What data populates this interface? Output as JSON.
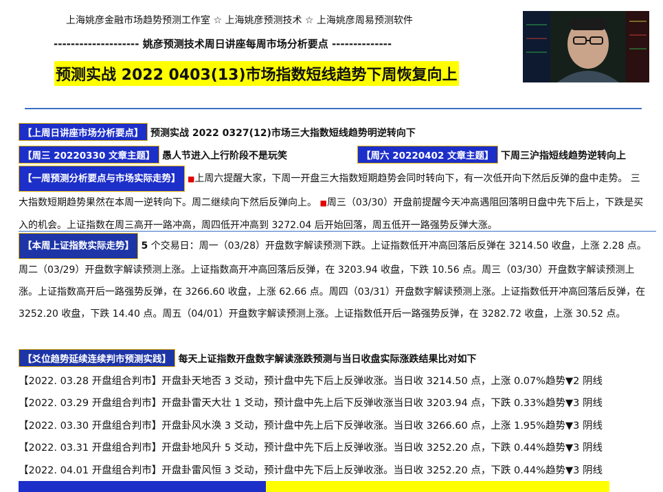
{
  "header": {
    "studio_line": "上海姚彦金融市场趋势预测工作室 ☆ 上海姚彦预测技术 ☆ 上海姚彦周易预测软件",
    "subtitle_line": "--------------------  姚彦预测技术周日讲座每周市场分析要点    --------------",
    "title": "预测实战 2022 0403(13)市场指数短线趋势下周恢复向上"
  },
  "last_week": {
    "tag": "【上周日讲座市场分析要点】",
    "text": "预测实战 2022 0327(12)市场三大指数短线趋势明逆转向下"
  },
  "wed": {
    "tag": "【周三 20220330 文章主题】",
    "text": "愚人节进入上行阶段不是玩笑"
  },
  "sat": {
    "tag": "【周六 20220402 文章主题】",
    "text": "下周三沪指短线趋势逆转向上"
  },
  "weekly_forecast": {
    "tag": "【一周预测分析要点与市场实际走势】",
    "marker1": "■",
    "text1": "上周六提醒大家，下周一开盘三大指数短期趋势会同时转向下，有一次低开向下然后反弹的盘中走势。 三大指数短期趋势果然在本周一逆转向下。周二继续向下然后反弹向上。",
    "marker2": "■",
    "text2": "周三（03/30）开盘前提醒今天冲高遇阻回落明日盘中先下后上，下跌是买入的机会。上证指数在周三高开一路冲高，周四低开冲高到 3272.04 后开始回落，周五低开一路强势反弹大涨。"
  },
  "actual": {
    "tag": "【本周上证指数实际走势】",
    "lead": "5",
    "text": " 个交易日：周一（03/28）开盘数字解读预测下跌。上证指数低开冲高回落后反弹在 3214.50 收盘，上涨 2.28 点。周二（03/29）开盘数字解读预测上涨。上证指数高开冲高回落后反弹，在 3203.94 收盘，下跌 10.56 点。周三（03/30）开盘数字解读预测上涨。上证指数高开后一路强势反弹，在 3266.60 收盘，上涨 62.66 点。周四（03/31）开盘数字解读预测上涨。上证指数低开冲高回落后反弹，在 3252.20 收盘，下跌 14.40 点。周五（04/01）开盘数字解读预测上涨。上证指数低开后一路强势反弹，在 3282.72 收盘，上涨 30.52 点。"
  },
  "yao": {
    "tag": "【爻位趋势延续连续判市预测实践】",
    "text": "每天上证指数开盘数字解读涨跌预测与当日收盘实际涨跌结果比对如下",
    "rows": [
      "【2022. 03.28 开盘组合判市】开盘卦天地否 3 爻动，预计盘中先下后上反弹收涨。当日收 3214.50 点，上涨 0.07%趋势▼2 阴线",
      "【2022. 03.29 开盘组合判市】开盘卦雷天大壮 1 爻动，预计盘中先上后下反弹收涨当日收 3203.94 点，下跌 0.33%趋势▼3 阴线",
      "【2022. 03.30 开盘组合判市】开盘卦风水涣 3 爻动，预计盘中先上后下反弹收涨。当日收 3266.60 点，上涨 1.95%趋势▼3 阴线",
      "【2022. 03.31 开盘组合判市】开盘卦地风升 5 爻动，预计盘中先下后上反弹收涨。当日收 3252.20 点，下跌 0.44%趋势▼3 阴线",
      "【2022. 04.01 开盘组合判市】开盘卦雷风恒 3 爻动，预计盘中先下后上反弹收涨。当日收 3252.20 点，下跌 0.44%趋势▼3 阴线"
    ]
  }
}
